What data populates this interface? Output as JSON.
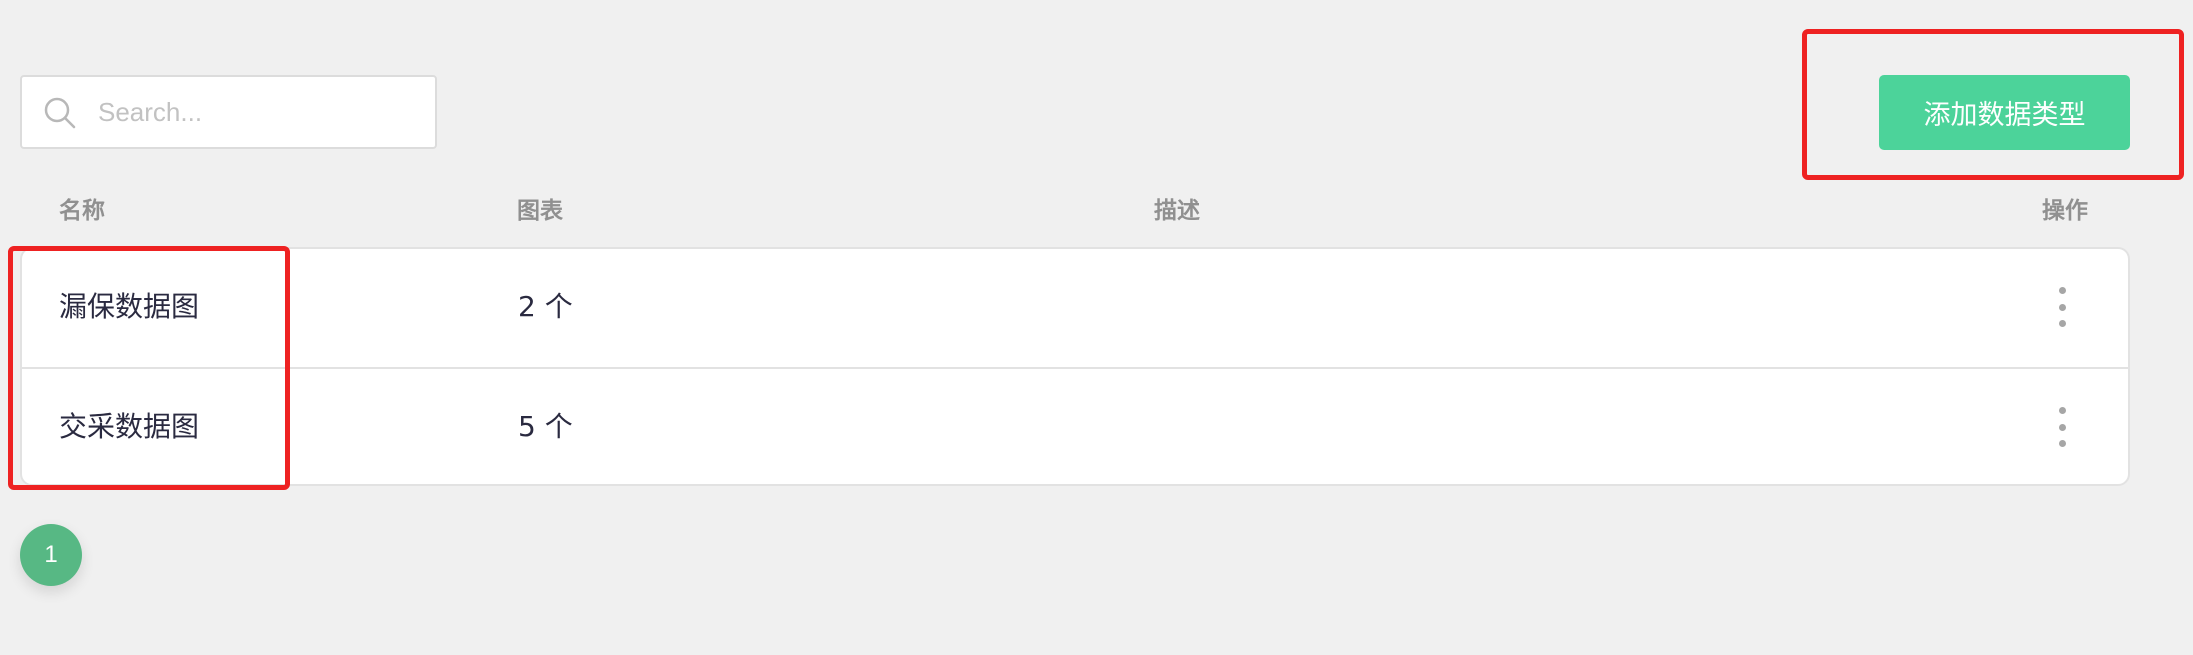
{
  "search": {
    "placeholder": "Search...",
    "value": "",
    "icon": "search-icon"
  },
  "toolbar": {
    "add_label": "添加数据类型",
    "add_color": "#4cd39a"
  },
  "table": {
    "headers": {
      "name": "名称",
      "chart": "图表",
      "description": "描述",
      "actions": "操作"
    },
    "rows": [
      {
        "name": "漏保数据图",
        "chart": "2 个",
        "description": "",
        "actions_icon": "more-vertical-icon"
      },
      {
        "name": "交采数据图",
        "chart": "5 个",
        "description": "",
        "actions_icon": "more-vertical-icon"
      }
    ]
  },
  "pagination": {
    "current": "1",
    "color": "#57b884"
  },
  "annotations": {
    "highlight_color": "#ee2222"
  }
}
